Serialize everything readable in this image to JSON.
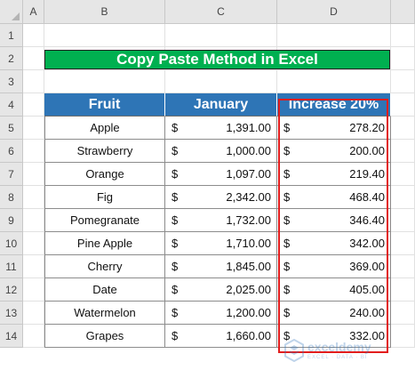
{
  "columns": [
    "A",
    "B",
    "C",
    "D"
  ],
  "rows": [
    "1",
    "2",
    "3",
    "4",
    "5",
    "6",
    "7",
    "8",
    "9",
    "10",
    "11",
    "12",
    "13",
    "14"
  ],
  "title": "Copy Paste Method in Excel",
  "headers": {
    "fruit": "Fruit",
    "january": "January",
    "increase": "Increase 20%"
  },
  "currency_symbol": "$",
  "table": [
    {
      "fruit": "Apple",
      "january": "1,391.00",
      "increase": "278.20"
    },
    {
      "fruit": "Strawberry",
      "january": "1,000.00",
      "increase": "200.00"
    },
    {
      "fruit": "Orange",
      "january": "1,097.00",
      "increase": "219.40"
    },
    {
      "fruit": "Fig",
      "january": "2,342.00",
      "increase": "468.40"
    },
    {
      "fruit": "Pomegranate",
      "january": "1,732.00",
      "increase": "346.40"
    },
    {
      "fruit": "Pine Apple",
      "january": "1,710.00",
      "increase": "342.00"
    },
    {
      "fruit": "Cherry",
      "january": "1,845.00",
      "increase": "369.00"
    },
    {
      "fruit": "Date",
      "january": "2,025.00",
      "increase": "405.00"
    },
    {
      "fruit": "Watermelon",
      "january": "1,200.00",
      "increase": "240.00"
    },
    {
      "fruit": "Grapes",
      "january": "1,660.00",
      "increase": "332.00"
    }
  ],
  "watermark": {
    "name": "exceldemy",
    "tagline": "EXCEL · DATA · BI"
  },
  "colors": {
    "title_bg": "#00b050",
    "header_bg": "#2e75b6",
    "highlight": "#e21d1d",
    "sheet_header_bg": "#e6e6e6"
  }
}
